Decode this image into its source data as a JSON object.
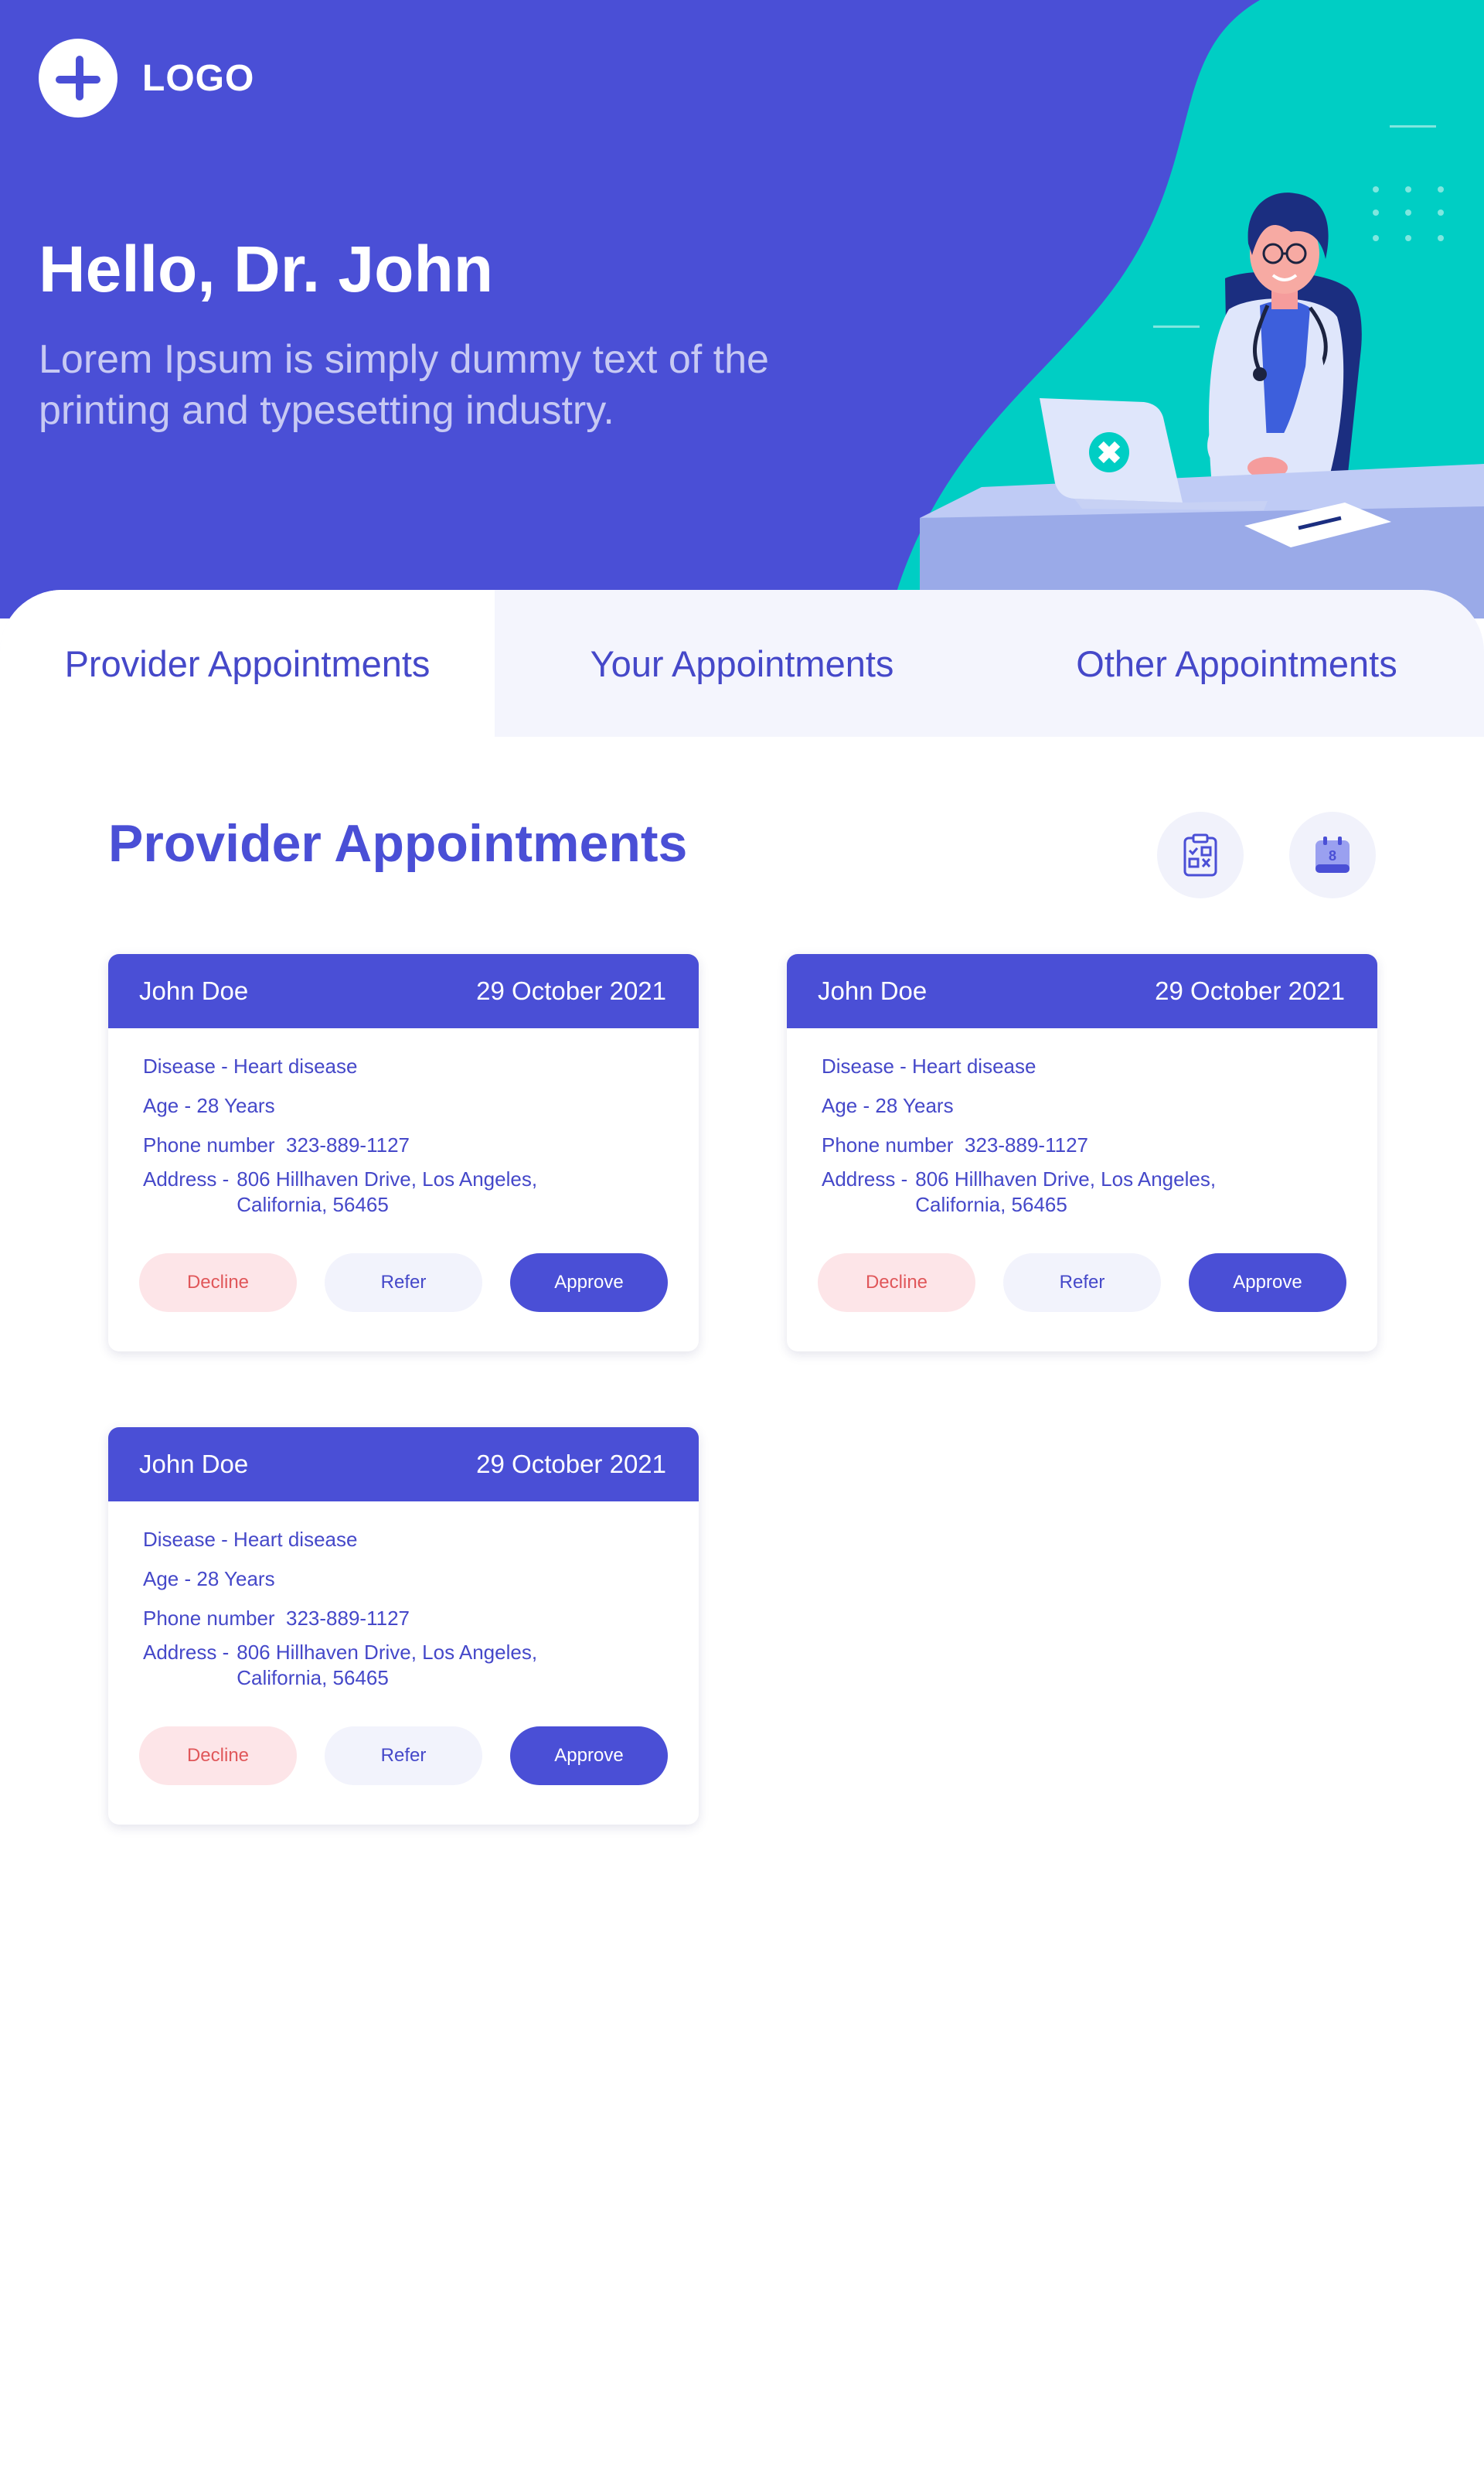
{
  "brand": {
    "logo_text": "LOGO",
    "primary_color": "#4a4fd6",
    "accent_color": "#00cec4"
  },
  "hero": {
    "greeting": "Hello, Dr. John",
    "subtitle": "Lorem Ipsum is simply dummy text of the printing and typesetting industry."
  },
  "tabs": [
    {
      "label": "Provider Appointments",
      "active": true
    },
    {
      "label": "Your Appointments",
      "active": false
    },
    {
      "label": "Other Appointments",
      "active": false
    }
  ],
  "section": {
    "title": "Provider Appointments",
    "actions": [
      {
        "icon": "clipboard-checklist-icon"
      },
      {
        "icon": "calendar-icon",
        "value": "8"
      }
    ]
  },
  "appointments": [
    {
      "name": "John Doe",
      "date": "29 October 2021",
      "disease": "Disease - Heart disease",
      "age": "Age - 28 Years",
      "phone_label": "Phone number",
      "phone": "323-889-1127",
      "address_label": "Address -",
      "address_line1": "806 Hillhaven Drive, Los Angeles,",
      "address_line2": "California, 56465",
      "decline_label": "Decline",
      "refer_label": "Refer",
      "approve_label": "Approve"
    },
    {
      "name": "John Doe",
      "date": "29 October 2021",
      "disease": "Disease - Heart disease",
      "age": "Age - 28 Years",
      "phone_label": "Phone number",
      "phone": "323-889-1127",
      "address_label": "Address -",
      "address_line1": "806 Hillhaven Drive, Los Angeles,",
      "address_line2": "California, 56465",
      "decline_label": "Decline",
      "refer_label": "Refer",
      "approve_label": "Approve"
    },
    {
      "name": "John Doe",
      "date": "29 October 2021",
      "disease": "Disease - Heart disease",
      "age": "Age - 28 Years",
      "phone_label": "Phone number",
      "phone": "323-889-1127",
      "address_label": "Address -",
      "address_line1": "806 Hillhaven Drive, Los Angeles,",
      "address_line2": "California, 56465",
      "decline_label": "Decline",
      "refer_label": "Refer",
      "approve_label": "Approve"
    }
  ]
}
